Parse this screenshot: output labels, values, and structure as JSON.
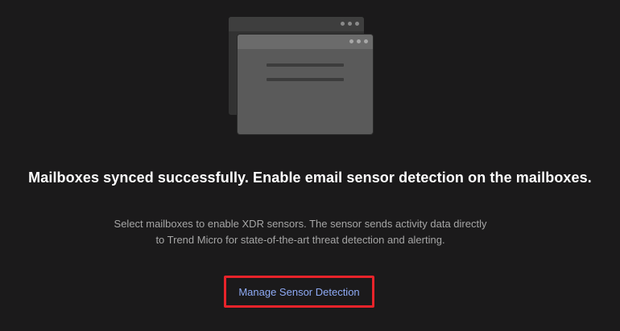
{
  "headline": "Mailboxes synced successfully. Enable email sensor detection on the mailboxes.",
  "description": {
    "line1": "Select mailboxes to enable XDR sensors. The sensor sends activity data directly",
    "line2": "to Trend Micro for state-of-the-art threat detection and alerting."
  },
  "action": {
    "manage_label": "Manage Sensor Detection"
  },
  "colors": {
    "background": "#1b1a1b",
    "link": "#8eaaf5",
    "highlight": "#e8232a"
  }
}
